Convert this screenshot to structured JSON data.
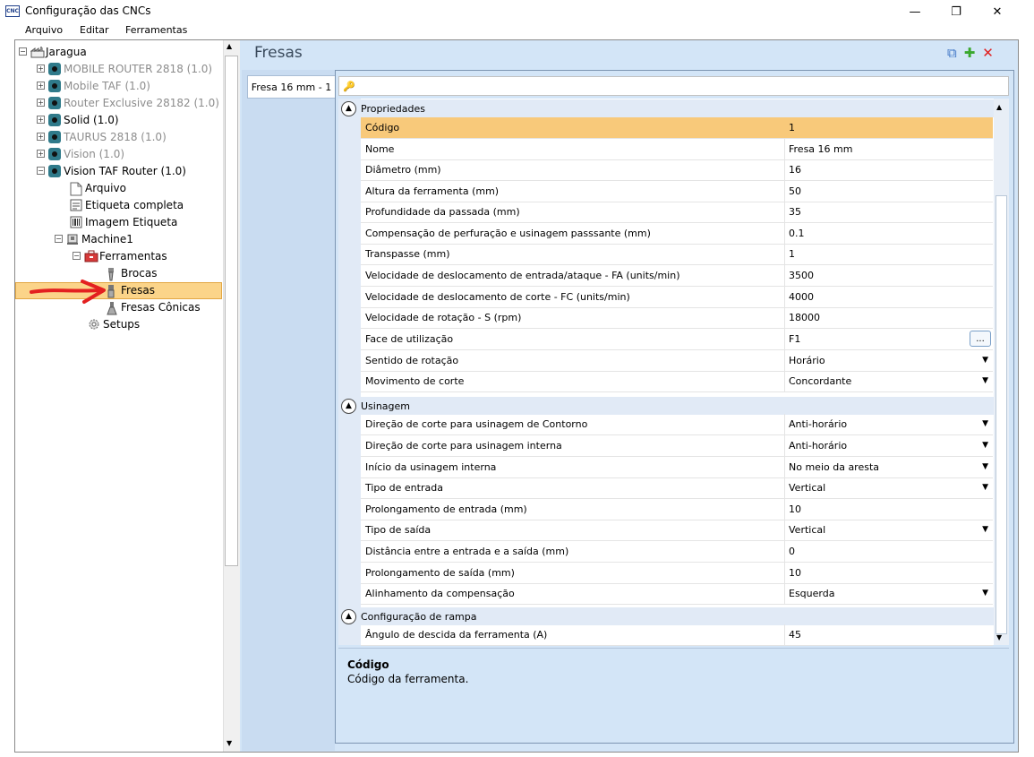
{
  "window": {
    "app_icon_text": "CNC",
    "title": "Configuração das CNCs",
    "controls": {
      "minimize": "—",
      "restore": "❐",
      "close": "✕"
    }
  },
  "menubar": {
    "items": [
      "Arquivo",
      "Editar",
      "Ferramentas"
    ]
  },
  "tree": {
    "root": "Jaragua",
    "machines": [
      {
        "label": "MOBILE ROUTER 2818 (1.0)",
        "dimmed": true
      },
      {
        "label": "Mobile TAF (1.0)",
        "dimmed": true
      },
      {
        "label": "Router Exclusive 28182 (1.0)",
        "dimmed": true
      },
      {
        "label": "Solid (1.0)",
        "dimmed": false
      },
      {
        "label": "TAURUS 2818 (1.0)",
        "dimmed": true
      },
      {
        "label": "Vision (1.0)",
        "dimmed": true
      },
      {
        "label": "Vision TAF Router (1.0)",
        "dimmed": false
      }
    ],
    "children": [
      "Arquivo",
      "Etiqueta completa",
      "Imagem Etiqueta",
      "Machine1"
    ],
    "machine_children": [
      "Ferramentas"
    ],
    "tools": [
      "Brocas",
      "Fresas",
      "Fresas Cônicas"
    ],
    "setups": "Setups",
    "selected": "Fresas"
  },
  "panel": {
    "title": "Fresas",
    "tool_icons": [
      "copy-icon",
      "add-icon",
      "delete-icon"
    ],
    "tabs": [
      "Fresa 16 mm - 1"
    ],
    "search_placeholder": ""
  },
  "grid": {
    "categories": [
      {
        "name": "Propriedades",
        "rows": [
          {
            "name": "Código",
            "value": "1"
          },
          {
            "name": "Nome",
            "value": "Fresa 16 mm"
          },
          {
            "name": "Diâmetro (mm)",
            "value": "16"
          },
          {
            "name": "Altura da ferramenta (mm)",
            "value": "50"
          },
          {
            "name": "Profundidade da passada (mm)",
            "value": "35"
          },
          {
            "name": "Compensação de perfuração e usinagem passsante (mm)",
            "value": "0.1"
          },
          {
            "name": "Transpasse (mm)",
            "value": "1"
          },
          {
            "name": "Velocidade de deslocamento de entrada/ataque - FA (units/min)",
            "value": "3500"
          },
          {
            "name": "Velocidade de deslocamento de corte - FC (units/min)",
            "value": "4000"
          },
          {
            "name": "Velocidade de rotação - S (rpm)",
            "value": "18000"
          },
          {
            "name": "Face de utilização",
            "value": "F1"
          },
          {
            "name": "Sentido de rotação",
            "value": "Horário"
          },
          {
            "name": "Movimento de corte",
            "value": "Concordante"
          }
        ]
      },
      {
        "name": "Usinagem",
        "rows": [
          {
            "name": "Direção de corte para usinagem de Contorno",
            "value": "Anti-horário"
          },
          {
            "name": "Direção de corte para usinagem interna",
            "value": "Anti-horário"
          },
          {
            "name": "Início da usinagem interna",
            "value": "No meio da aresta"
          },
          {
            "name": "Tipo de entrada",
            "value": "Vertical"
          },
          {
            "name": "Prolongamento de entrada (mm)",
            "value": "10"
          },
          {
            "name": "Tipo de saída",
            "value": "Vertical"
          },
          {
            "name": "Distância entre a entrada e a saída (mm)",
            "value": "0"
          },
          {
            "name": "Prolongamento de saída (mm)",
            "value": "10"
          },
          {
            "name": "Alinhamento da compensação",
            "value": "Esquerda"
          }
        ]
      },
      {
        "name": "Configuração de rampa",
        "rows": [
          {
            "name": "Ângulo de descida da ferramenta (A)",
            "value": "45"
          }
        ]
      }
    ],
    "ellipsis_label": "...",
    "selected_row": "Código"
  },
  "description": {
    "title": "Código",
    "text": "Código da ferramenta."
  },
  "colors": {
    "selection": "#fbd489",
    "panel_bg": "#d3e5f7",
    "category_bg": "#e1eaf6",
    "arrow": "#e32020"
  }
}
